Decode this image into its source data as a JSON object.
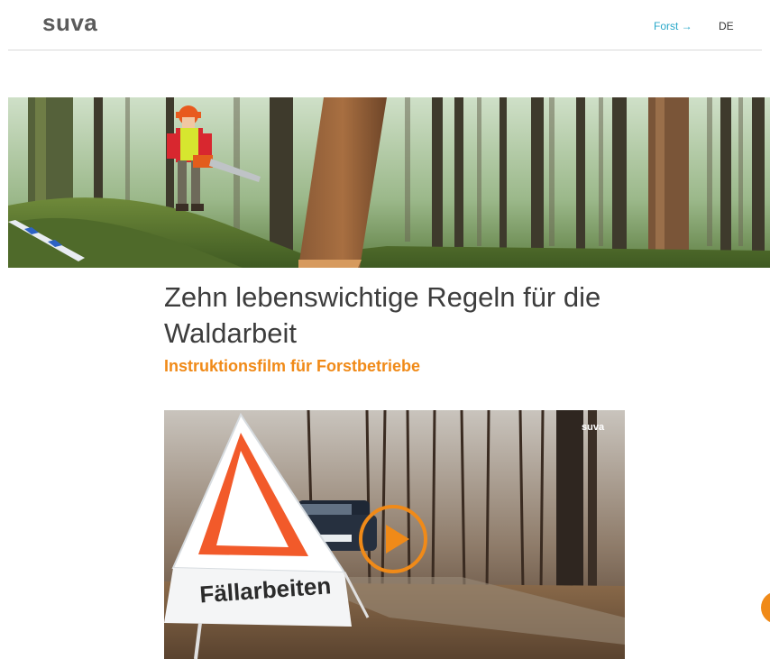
{
  "header": {
    "logo": "suva",
    "nav_forst": "Forst →",
    "nav_lang": "DE"
  },
  "main": {
    "title": "Zehn lebenswichtige Regeln für die Waldarbeit",
    "subtitle": "Instruktionsfilm für Forstbetriebe"
  },
  "video": {
    "logo_text": "suva",
    "play_icon": "play-icon"
  },
  "colors": {
    "accent": "#f08a18",
    "link": "#2aa8c9",
    "text": "#3d3d3d",
    "logo": "#5b5b5b"
  }
}
